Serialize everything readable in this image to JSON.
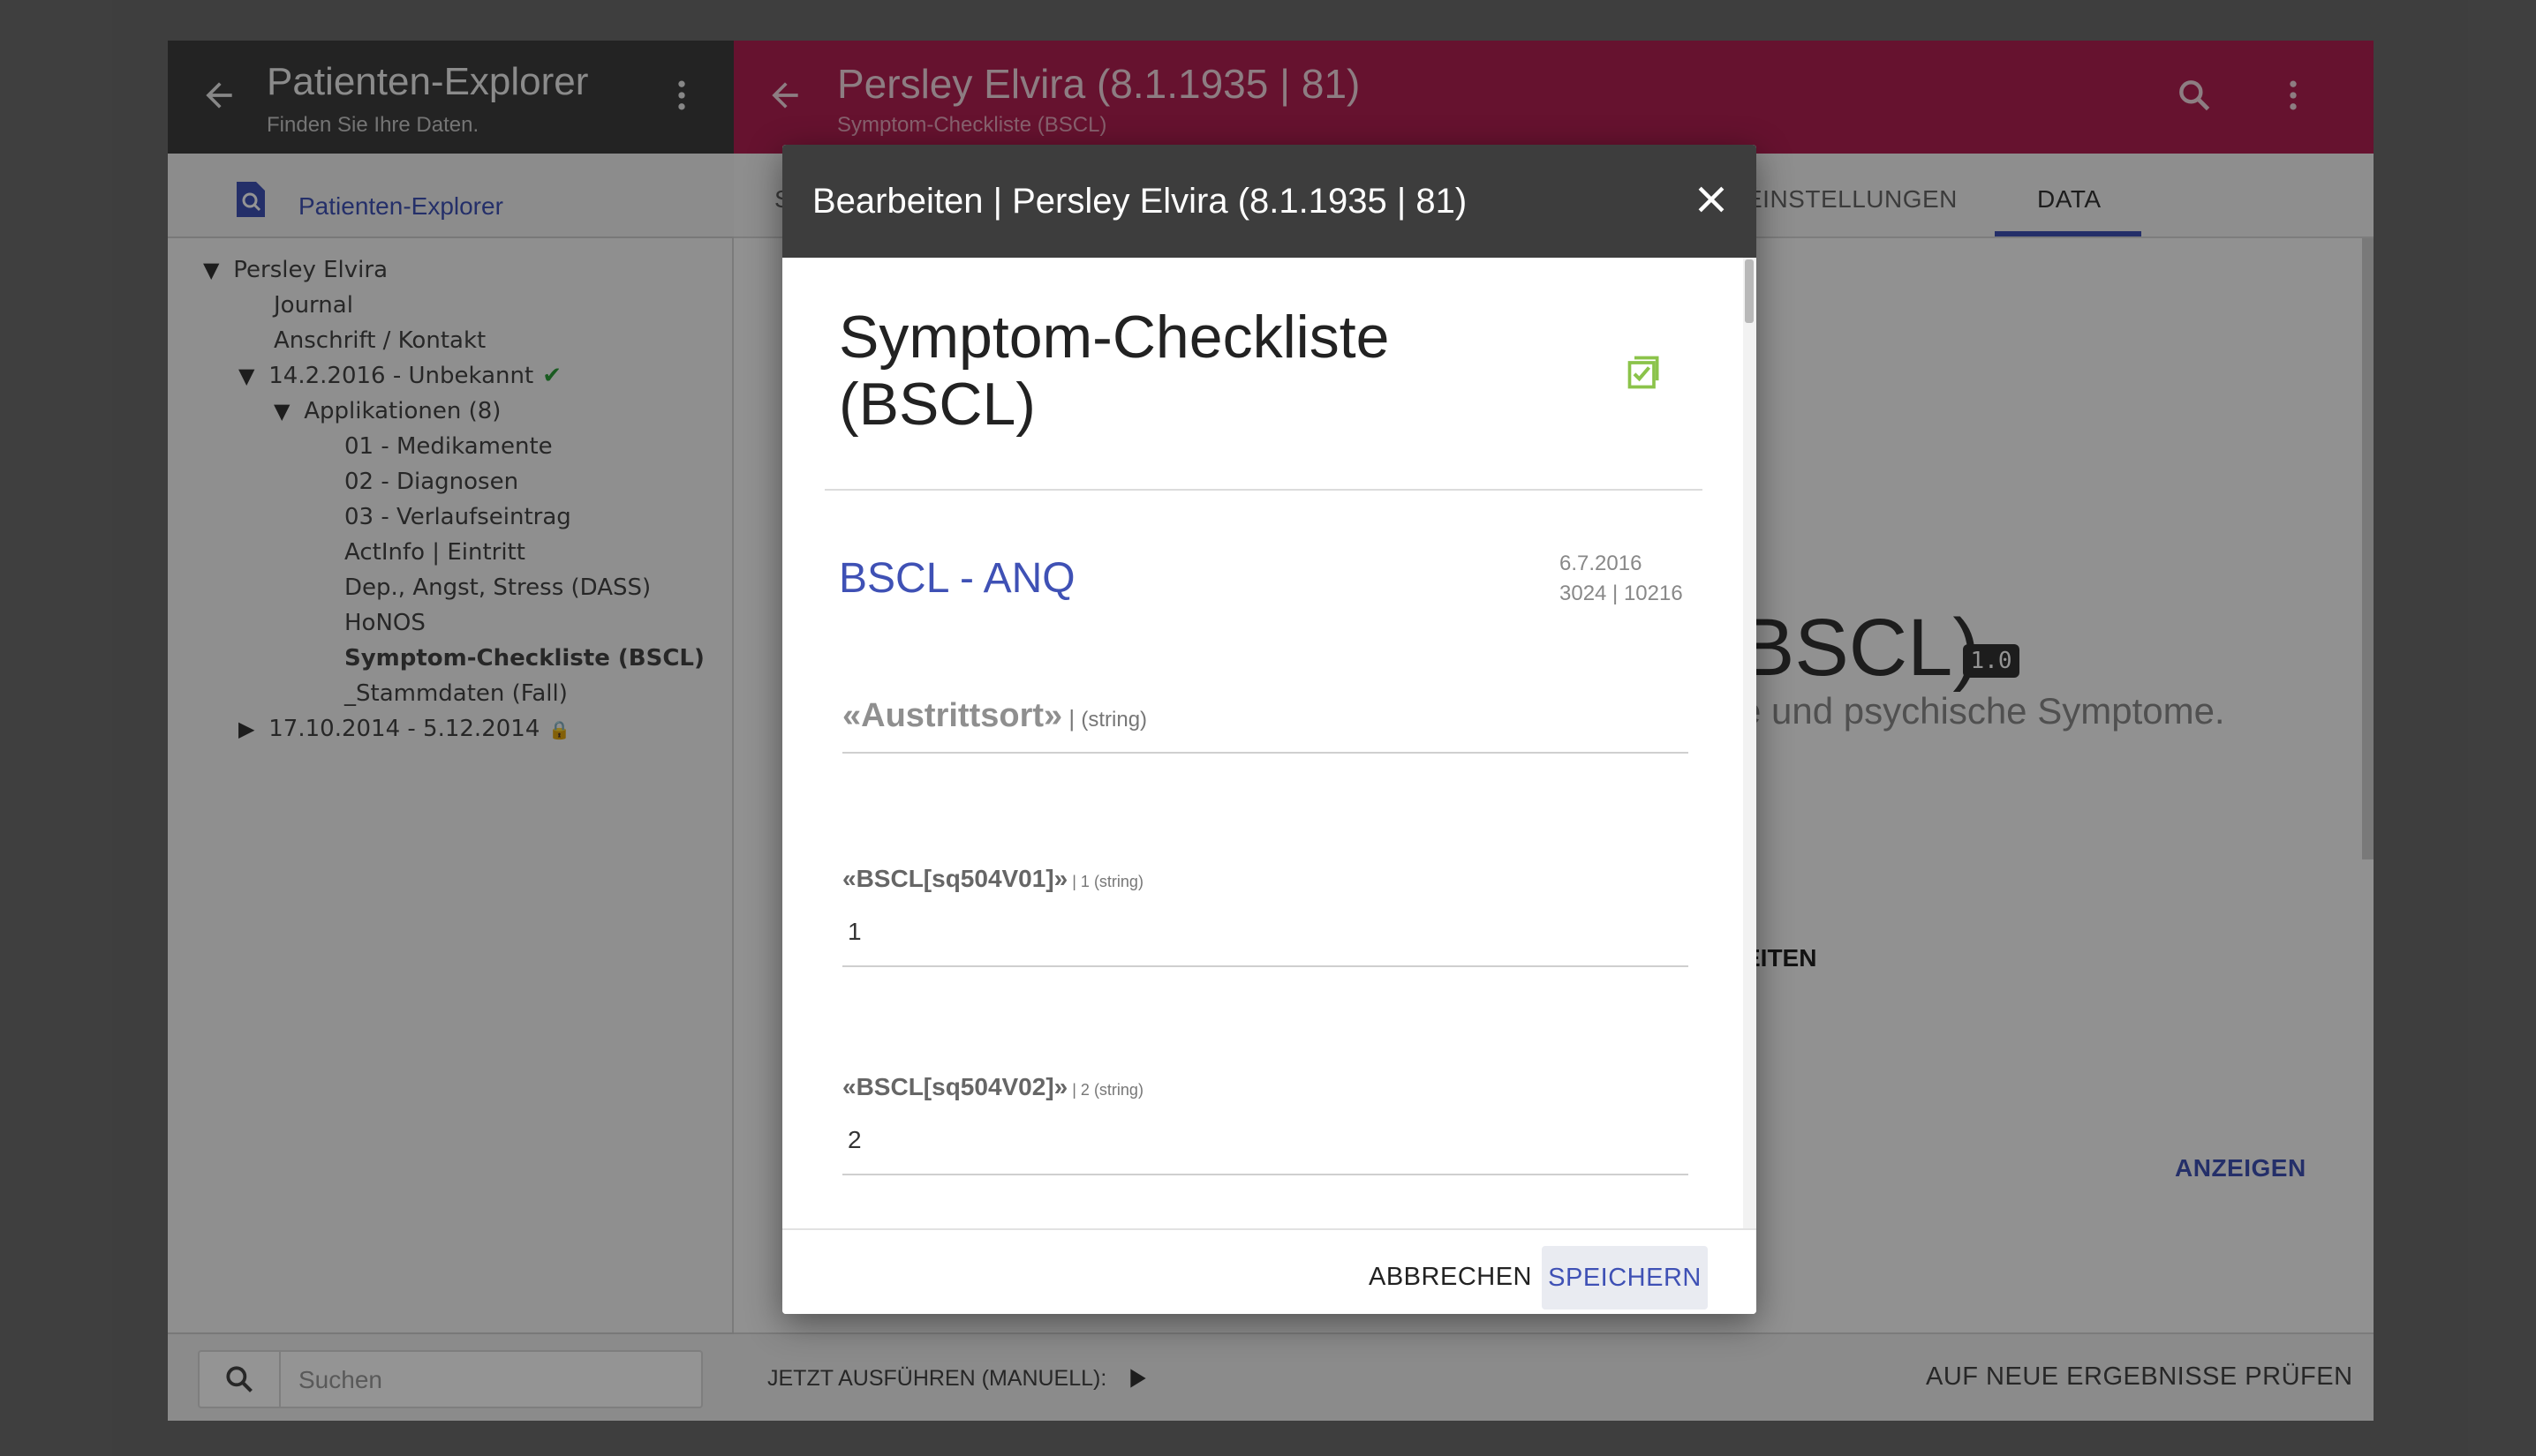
{
  "left_panel": {
    "title": "Patienten-Explorer",
    "subtitle": "Finden Sie Ihre Daten.",
    "nav_label": "Patienten-Explorer",
    "tree": [
      {
        "label": "Persley Elvira",
        "expanded": true
      },
      {
        "label": "Journal"
      },
      {
        "label": "Anschrift / Kontakt"
      },
      {
        "label": "14.2.2016 - Unbekannt",
        "expanded": true,
        "status": "check-icon"
      },
      {
        "label": "Applikationen (8)",
        "expanded": true
      },
      {
        "label": "01 - Medikamente"
      },
      {
        "label": "02 - Diagnosen"
      },
      {
        "label": "03 - Verlaufseintrag"
      },
      {
        "label": "ActInfo | Eintritt"
      },
      {
        "label": "Dep., Angst, Stress (DASS)"
      },
      {
        "label": "HoNOS"
      },
      {
        "label": "Symptom-Checkliste (BSCL)",
        "selected": true
      },
      {
        "label": "_Stammdaten (Fall)"
      },
      {
        "label": "17.10.2014 - 5.12.2014",
        "expanded": false,
        "status": "lock-icon"
      }
    ],
    "search_placeholder": "Suchen"
  },
  "right_panel": {
    "title": "Persley Elvira (8.1.1935 | 81)",
    "subtitle": "Symptom-Checkliste (BSCL)",
    "tabs": [
      {
        "label": "S"
      },
      {
        "label": "EINSTELLUNGEN"
      },
      {
        "label": "DATA",
        "active": true
      }
    ],
    "content_title": "BSCL)",
    "version_badge": "1.0",
    "content_desc": "e und psychische Symptome.",
    "action_partial": "EITEN",
    "show_button": "ANZEIGEN",
    "run_label": "JETZT AUSFÜHREN (MANUELL):",
    "check_results": "AUF NEUE ERGEBNISSE PRÜFEN"
  },
  "dialog": {
    "title": "Bearbeiten | Persley Elvira (8.1.1935 | 81)",
    "form_title": "Symptom-Checkliste (BSCL)",
    "section_title": "BSCL - ANQ",
    "section_date": "6.7.2016",
    "section_ids": "3024 | 10216",
    "fields": [
      {
        "name": "«Austrittsort»",
        "separator": " | ",
        "type": "(string)",
        "value": ""
      },
      {
        "name": "«BSCL[sq504V01]»",
        "separator": " | 1 ",
        "type": "(string)",
        "value": "1"
      },
      {
        "name": "«BSCL[sq504V02]»",
        "separator": " | 2 ",
        "type": "(string)",
        "value": "2"
      }
    ],
    "cancel_label": "ABBRECHEN",
    "save_label": "SPEICHERN"
  },
  "colors": {
    "accent": "#3f51b5",
    "header_right": "#b01f51",
    "header_left": "#3d3d3d",
    "check": "#2e9e3a",
    "form_icon": "#8bc34a"
  }
}
